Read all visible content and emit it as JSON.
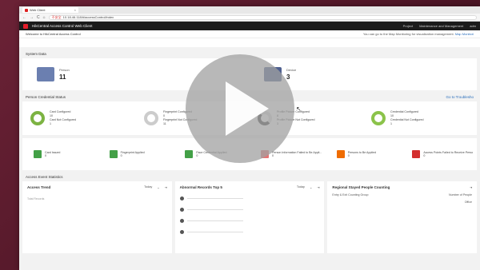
{
  "browser": {
    "tab_title": "Web Client",
    "tab_close": "×",
    "nav_back": "←",
    "nav_forward": "→",
    "nav_refresh": "C",
    "home": "⌂",
    "security_label": "不安全",
    "url": "10.18.46.118/#/accessControl/index"
  },
  "app": {
    "title": "HikCentral Access Control Web Client",
    "header_right": [
      "Project",
      "Maintenance and Management",
      "adm"
    ]
  },
  "welcome": {
    "left": "Welcome to HikCentral Access Control",
    "right_text": "You can go to the Map Monitoring for visualization management.",
    "right_link": "Map Monitori"
  },
  "system_data": {
    "title": "System Data",
    "items": [
      {
        "label": "Person",
        "value": "11"
      },
      {
        "label": "Device",
        "value": "3"
      }
    ]
  },
  "credential": {
    "title": "Person Credential Status",
    "link": "Go to Troublesho",
    "items": [
      {
        "l1": "Card Configured",
        "v1": "10",
        "l2": "Card Not Configured",
        "v2": "1"
      },
      {
        "l1": "Fingerprint Configured",
        "v1": "0",
        "l2": "Fingerprint Not Configured",
        "v2": "11"
      },
      {
        "l1": "Profile Picture Configured",
        "v1": "8",
        "l2": "Profile Picture Not Configured",
        "v2": "3"
      },
      {
        "l1": "Credential Configured",
        "v1": "10",
        "l2": "Credential Not Configured",
        "v2": "1"
      }
    ],
    "actions": [
      {
        "label": "Card Issued",
        "value": "0"
      },
      {
        "label": "Fingerprint Applied",
        "value": "0"
      },
      {
        "label": "Face Credential Applied",
        "value": "0"
      },
      {
        "label": "Person Information Failed to Be Appli...",
        "value": "0"
      },
      {
        "label": "Persons to Be Applied",
        "value": "0"
      },
      {
        "label": "Access Points Failed to Receive Perso",
        "value": "0"
      }
    ]
  },
  "access_stats": {
    "title": "Access Event Statistics",
    "trend": {
      "title": "Access Trend",
      "range": "Today",
      "axis": "Total Records"
    },
    "abnormal": {
      "title": "Abnormal Records Top 5",
      "range": "Today"
    },
    "regional": {
      "title": "Regional Stayed People Counting",
      "col1": "Entry & Exit Counting Group",
      "col2": "Number of People",
      "row": "Office"
    }
  },
  "player": {
    "state": "paused"
  },
  "colors": {
    "app_header": "#1b1b1b",
    "brand": "#e21d2b",
    "link": "#2a6ebb"
  }
}
